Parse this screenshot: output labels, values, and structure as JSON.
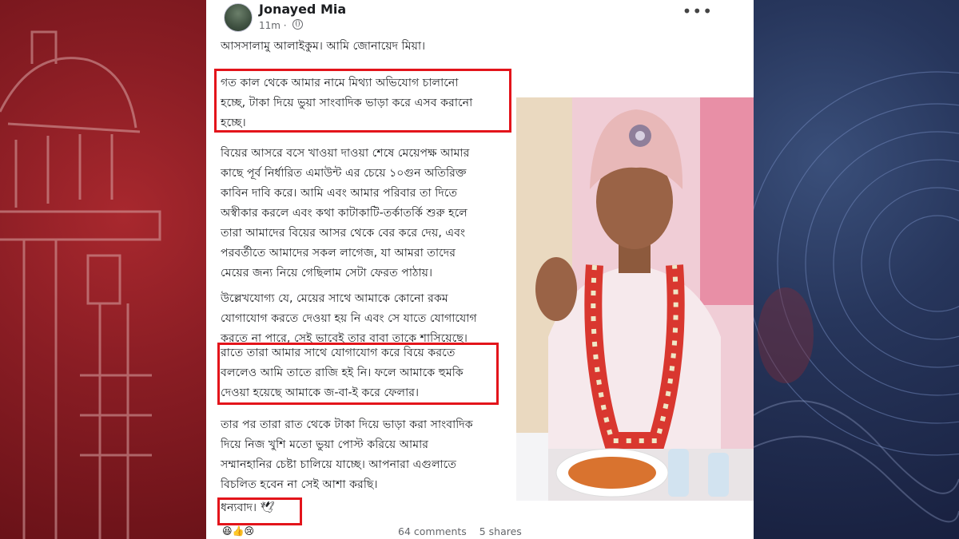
{
  "post": {
    "author": "Jonayed Mia",
    "time": "11m",
    "greeting": "আসসালামু আলাইকুম। আমি জোনায়েদ মিয়া।",
    "para1": "গত কাল থেকে আমার নামে মিথ্যা অভিযোগ চালানো\nহচ্ছে, টাকা দিয়ে ভুয়া সাংবাদিক ভাড়া করে এসব করানো\nহচ্ছে।",
    "para2": "বিয়ের আসরে বসে খাওয়া দাওয়া শেষে মেয়েপক্ষ আমার\nকাছে পূর্ব নির্ধারিত এমাউন্ট এর চেয়ে ১০গুন অতিরিক্ত\nকাবিন দাবি করে। আমি এবং আমার পরিবার তা দিতে\nঅস্বীকার করলে এবং কথা কাটাকাটি-তর্কাতর্কি শুরু হলে\nতারা আমাদের বিয়ের আসর থেকে বের করে দেয়, এবং\nপরবর্তীতে আমাদের সকল লাগেজ, যা আমরা তাদের\nমেয়ের জন্য নিয়ে গেছিলাম সেটা ফেরত পাঠায়।",
    "para3": "উল্লেখযোগ্য যে, মেয়ের সাথে আমাকে কোনো রকম\nযোগাযোগ করতে দেওয়া হয় নি এবং সে যাতে যোগাযোগ\nকরতে না পারে, সেই ভাবেই তার বাবা তাকে শাসিয়েছে।",
    "para4": "রাতে তারা আমার সাথে যোগাযোগ করে বিয়ে করতে\nবললেও আমি তাতে রাজি হই নি। ফলে আমাকে হুমকি\nদেওয়া হয়েছে আমাকে জ-বা-ই করে ফেলার।",
    "para5": "তার পর তারা রাত থেকে টাকা দিয়ে ভাড়া করা সাংবাদিক\nদিয়ে নিজ খুশি মতো ভুয়া পোস্ট করিয়ে আমার\nসম্মানহানির চেষ্টা চালিয়ে যাচ্ছে। আপনারা এগুলাতে\nবিচলিত হবেন না সেই আশা করছি।",
    "thanks": "ধন্যবাদ। 🕊",
    "reactions": "😆👍😢",
    "comments": "64 comments",
    "shares": "5 shares"
  },
  "colors": {
    "highlight": "#e3141b",
    "left_bg": "#8a1d24",
    "right_bg": "#1b2447"
  },
  "icons": {
    "more": "more-options-icon",
    "globe": "globe-icon"
  }
}
